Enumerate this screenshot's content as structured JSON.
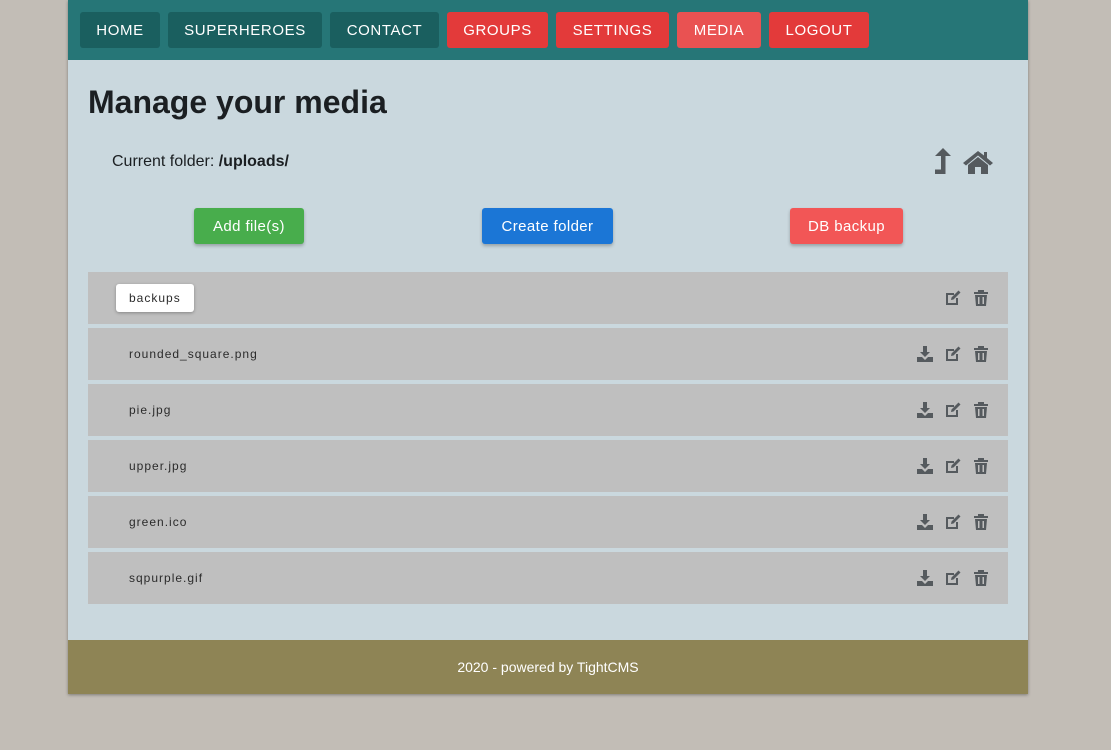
{
  "nav": {
    "items": [
      {
        "label": "HOME"
      },
      {
        "label": "SUPERHEROES"
      },
      {
        "label": "CONTACT"
      },
      {
        "label": "GROUPS"
      },
      {
        "label": "SETTINGS"
      },
      {
        "label": "MEDIA"
      },
      {
        "label": "LOGOUT"
      }
    ]
  },
  "page": {
    "title": "Manage your media",
    "folder_label": "Current folder:",
    "folder_path": "/uploads/"
  },
  "icons": {
    "up": "arrow-up-icon",
    "home": "home-icon",
    "download": "download-icon",
    "edit": "edit-icon",
    "delete": "trash-icon"
  },
  "actions": {
    "add_files": "Add file(s)",
    "create_folder": "Create folder",
    "db_backup": "DB backup"
  },
  "colors": {
    "navbar": "#267677",
    "nav_teal": "#1a5f5f",
    "nav_red": "#e33a3a",
    "add_button": "#48ad4c",
    "create_button": "#1b76d6",
    "backup_button": "#f25656",
    "footer": "#8e8455"
  },
  "items": [
    {
      "name": "backups",
      "type": "folder"
    },
    {
      "name": "rounded_square.png",
      "type": "file"
    },
    {
      "name": "pie.jpg",
      "type": "file"
    },
    {
      "name": "upper.jpg",
      "type": "file"
    },
    {
      "name": "green.ico",
      "type": "file"
    },
    {
      "name": "sqpurple.gif",
      "type": "file"
    }
  ],
  "footer": {
    "text": "2020 - powered by TightCMS"
  }
}
